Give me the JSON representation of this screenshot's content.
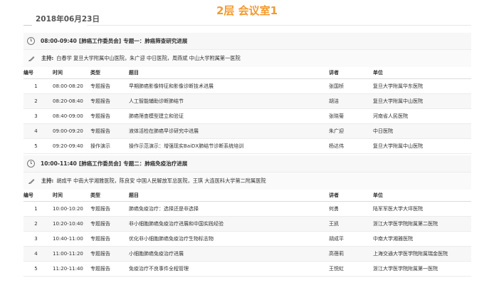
{
  "room_title": "2层 会议室1",
  "date": "2018年06月23日",
  "columns": {
    "idx": "编号",
    "time": "时间",
    "type": "类型",
    "topic": "题目",
    "speaker": "讲者",
    "unit": "单位"
  },
  "chair_label": "主持:",
  "sessions": [
    {
      "time": "08:00-09:40",
      "committee": "[肺癌工作委员会]",
      "topic": "专题一：肺癌筛查研究进展",
      "chairs": "白春学  复旦大学附属中山医院，朱广迎  中日医院，周燕斌  中山大学附属第一医院",
      "rows": [
        {
          "idx": "1",
          "time": "08:00-08:20",
          "type": "专题报告",
          "topic": "早期肺癌影像特征和影像诊断技术进展",
          "speaker": "张国桢",
          "unit": "复旦大学附属华东医院"
        },
        {
          "idx": "2",
          "time": "08:20-08:40",
          "type": "专题报告",
          "topic": "人工智能辅助诊断肺结节",
          "speaker": "胡洁",
          "unit": "复旦大学附属中山医院"
        },
        {
          "idx": "3",
          "time": "08:40-09:00",
          "type": "专题报告",
          "topic": "肺癌筛查模型建立和验证",
          "speaker": "张晓菊",
          "unit": "河南省人民医院"
        },
        {
          "idx": "4",
          "time": "09:00-09:20",
          "type": "专题报告",
          "topic": "液体活检在肺癌早诊研究中进展",
          "speaker": "朱广迎",
          "unit": "中日医院"
        },
        {
          "idx": "5",
          "time": "09:20-09:40",
          "type": "操作演示",
          "topic": "操作示范演示：增强现实BaiDX肺结节诊断系统培训",
          "speaker": "杨达伟",
          "unit": "复旦大学附属中山医院"
        }
      ]
    },
    {
      "time": "10:00-11:40",
      "committee": "[肺癌工作委员会]",
      "topic": "专题二：肺癌免疫治疗进展",
      "chairs": "胡成平  中南大学湘雅医院，陈良安  中国人民解放军总医院，王琪  大连医科大学第二附属医院",
      "rows": [
        {
          "idx": "1",
          "time": "10:00-10:20",
          "type": "专题报告",
          "topic": "肺癌免疫治疗：选择还是非选择",
          "speaker": "何勇",
          "unit": "陆军军医大学大坪医院"
        },
        {
          "idx": "2",
          "time": "10:20-10:40",
          "type": "专题报告",
          "topic": "非小细胞肺癌免疫治疗进展和中国实践经验",
          "speaker": "王凯",
          "unit": "浙江大学医学院附属第二医院"
        },
        {
          "idx": "3",
          "time": "10:40-11:00",
          "type": "专题报告",
          "topic": "优化非小细胞肺癌免疫治疗生物标志物",
          "speaker": "胡成平",
          "unit": "中南大学湘雅医院"
        },
        {
          "idx": "4",
          "time": "11:00-11:20",
          "type": "专题报告",
          "topic": "小细胞肺癌免疫治疗进展",
          "speaker": "高蓓莉",
          "unit": "上海交通大学医学院附属瑞金医院"
        },
        {
          "idx": "5",
          "time": "11:20-11:40",
          "type": "专题报告",
          "topic": "免疫治疗不良事件全程管理",
          "speaker": "王悦虹",
          "unit": "浙江大学医学院附属第一医院"
        }
      ]
    }
  ]
}
